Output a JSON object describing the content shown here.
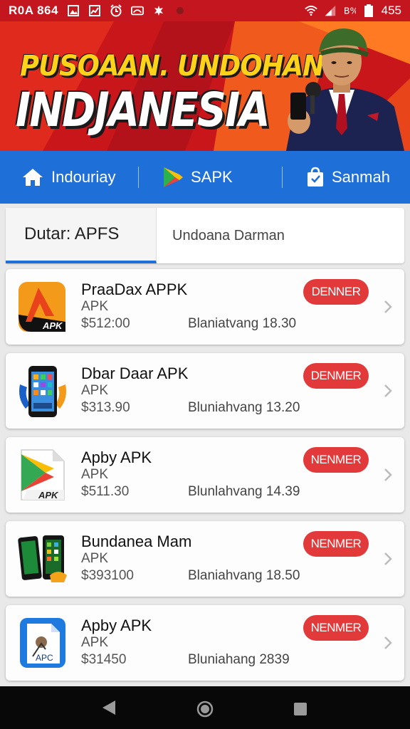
{
  "status_bar": {
    "carrier": "R0A 864",
    "battery": "455",
    "icons": [
      "photo-icon",
      "chart-icon",
      "alarm-icon",
      "cloud-icon",
      "settings-icon",
      "dot-icon",
      "wifi-icon",
      "signal-icon",
      "data-icon",
      "battery-icon"
    ]
  },
  "banner": {
    "line1": "PUSOAAN. UNDOHAN",
    "line2": "INDJANESIA"
  },
  "nav": {
    "items": [
      {
        "label": "Indouriay",
        "icon": "home-icon"
      },
      {
        "label": "SAPK",
        "icon": "play-store-icon"
      },
      {
        "label": "Sanmah",
        "icon": "shopping-bag-icon"
      }
    ]
  },
  "tabs": [
    {
      "label": "Dutar: APFS",
      "active": true
    },
    {
      "label": "Undoana Darman",
      "active": false
    }
  ],
  "apps": [
    {
      "name": "PraaDax APPK",
      "type": "APK",
      "price": "$512:00",
      "meta": "Blaniatvang 18.30",
      "button": "DENNER",
      "icon": "apk-orange-icon",
      "icon_label": "APK"
    },
    {
      "name": "Dbar Daar APK",
      "type": "APK",
      "price": "$313.90",
      "meta": "Bluniahvang 13.20",
      "button": "DENMER",
      "icon": "phone-app-icon",
      "icon_label": ""
    },
    {
      "name": "Apby APK",
      "type": "APK",
      "price": "$511.30",
      "meta": "Blunlahvang 14.39",
      "button": "NENMER",
      "icon": "apk-file-icon",
      "icon_label": "APK"
    },
    {
      "name": "Bundanea Mam",
      "type": "APK",
      "price": "$393100",
      "meta": "Blaniahvang 18.50",
      "button": "NENMER",
      "icon": "phones-icon",
      "icon_label": ""
    },
    {
      "name": "Apby APK",
      "type": "APK",
      "price": "$31450",
      "meta": "Bluniahang 2839",
      "button": "NENMER",
      "icon": "apc-file-icon",
      "icon_label": "APC"
    }
  ],
  "colors": {
    "status_bar": "#c4161f",
    "nav": "#1f6fd8",
    "button": "#e23a3a",
    "banner_yellow": "#ffd21a"
  }
}
